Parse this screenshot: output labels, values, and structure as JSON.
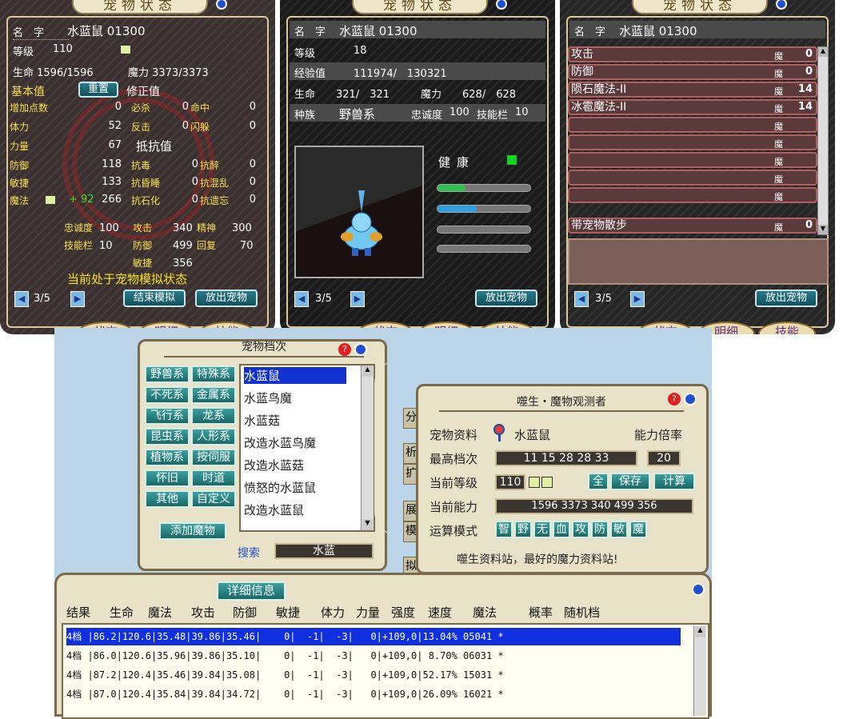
{
  "panel1": {
    "title": "宠物状态",
    "name_label": "名　字",
    "name": "水蓝鼠 01300",
    "level_label": "等级",
    "level": "110",
    "hp_line": "生命 1596/1596",
    "mp_line": "魔力 3373/3373",
    "base_label": "基本值",
    "reset_label": "重置",
    "correct_label": "修正值",
    "left_stats": [
      {
        "label": "增加点数",
        "value": "0"
      },
      {
        "label": "体力",
        "value": "52"
      },
      {
        "label": "力量",
        "value": "67"
      },
      {
        "label": "防御",
        "value": "118"
      },
      {
        "label": "敏捷",
        "value": "133"
      },
      {
        "label": "魔法",
        "value": "266",
        "plus": "+ 92"
      }
    ],
    "correct_stats": [
      {
        "label": "必杀",
        "value": "0"
      },
      {
        "label": "反击",
        "value": "0"
      }
    ],
    "correct_stats_right": [
      {
        "label": "命中",
        "value": "0"
      },
      {
        "label": "闪躲",
        "value": "0"
      }
    ],
    "resist_label": "抵抗值",
    "resist_left": [
      {
        "label": "抗毒",
        "value": "0"
      },
      {
        "label": "抗昏睡",
        "value": "0"
      },
      {
        "label": "抗石化",
        "value": "0"
      }
    ],
    "resist_right": [
      {
        "label": "抗醉",
        "value": "0"
      },
      {
        "label": "抗混乱",
        "value": "0"
      },
      {
        "label": "抗遗忘",
        "value": "0"
      }
    ],
    "loyalty_label": "忠诚度",
    "loyalty": "100",
    "skill_label": "技能栏",
    "skill": "10",
    "atk_label": "攻击",
    "atk": "340",
    "def_label": "防御",
    "def": "499",
    "agi_label": "敏捷",
    "agi": "356",
    "spirit_label": "精神",
    "spirit": "300",
    "recover_label": "回复",
    "recover": "70",
    "sim_notice": "当前处于宠物模拟状态",
    "page": "3/5",
    "end_sim": "结束模拟",
    "release": "放出宠物",
    "tabs": [
      "状态",
      "明细",
      "技能"
    ]
  },
  "panel2": {
    "title": "宠物状态",
    "name_label": "名　字",
    "name": "水蓝鼠 01300",
    "level_label": "等级",
    "level": "18",
    "exp_label": "经验值",
    "exp": "111974/　130321",
    "hp_label": "生命",
    "hp": "321/　321",
    "mp_label": "魔力",
    "mp": "628/　628",
    "race_label": "种族",
    "race": "野兽系",
    "loyalty_label": "忠诚度",
    "loyalty": "100",
    "skill_label": "技能栏",
    "skill": "10",
    "health_label": "健康",
    "page": "3/5",
    "release": "放出宠物",
    "tabs": [
      "状态",
      "明细",
      "技能"
    ],
    "colors": {
      "health": "#10d020",
      "bar1": "#30c050",
      "bar2": "#2aa0e0"
    }
  },
  "panel3": {
    "title": "宠物状态",
    "name_label": "名　字",
    "name": "水蓝鼠 01300",
    "skills": [
      {
        "name": "攻击",
        "mo": "魔",
        "lv": "0"
      },
      {
        "name": "防御",
        "mo": "魔",
        "lv": "0"
      },
      {
        "name": "陨石魔法-II",
        "mo": "魔",
        "lv": "14"
      },
      {
        "name": "冰雹魔法-II",
        "mo": "魔",
        "lv": "14"
      },
      {
        "name": "",
        "mo": "魔",
        "lv": ""
      },
      {
        "name": "",
        "mo": "魔",
        "lv": ""
      },
      {
        "name": "",
        "mo": "魔",
        "lv": ""
      },
      {
        "name": "",
        "mo": "魔",
        "lv": ""
      },
      {
        "name": "",
        "mo": "魔",
        "lv": ""
      },
      {
        "name": "带宠物散步",
        "mo": "魔",
        "lv": "0"
      }
    ],
    "page": "3/5",
    "release": "放出宠物",
    "tabs": [
      "状态",
      "明细",
      "技能"
    ]
  },
  "rank": {
    "title": "宠物档次",
    "categories": [
      "野兽系",
      "特殊系",
      "不死系",
      "金属系",
      "飞行系",
      "龙系",
      "昆虫系",
      "人形系",
      "植物系",
      "按伺服",
      "怀旧",
      "时道",
      "其他",
      "自定义"
    ],
    "list": [
      "水蓝鼠",
      "水蓝鸟魔",
      "水蓝菇",
      "改造水蓝鸟魔",
      "改造水蓝菇",
      "愤怒的水蓝鼠",
      "改造水蓝鼠"
    ],
    "add_label": "添加魔物",
    "search_label": "搜索",
    "search_value": "水蓝",
    "side_tabs": [
      "分",
      "析",
      "扩",
      "展",
      "模",
      "拟"
    ]
  },
  "observer": {
    "title": "噬生・魔物观测者",
    "pet_label": "宠物资料",
    "pet_name": "水蓝鼠",
    "ratio_label": "能力倍率",
    "max_label": "最高档次",
    "max_value": "11 15 28 28 33",
    "ratio_value": "20",
    "lv_label": "当前等级",
    "lv_value": "110",
    "all_label": "全",
    "save_label": "保存",
    "calc_label": "计算",
    "ability_label": "当前能力",
    "ability_value": "1596 3373 340 499 356",
    "mode_label": "运算模式",
    "modes": [
      "智",
      "野",
      "无",
      "血",
      "攻",
      "防",
      "敏",
      "魔"
    ],
    "footer": "噬生资料站，最好的魔力资料站!"
  },
  "details": {
    "button": "详细信息",
    "headers": [
      "结果",
      "生命",
      "魔法",
      "攻击",
      "防御",
      "敏捷",
      "体力",
      "力量",
      "强度",
      "速度",
      "魔法",
      "概率",
      "随机档"
    ],
    "rows": [
      "4档 |86.2|120.6|35.48|39.86|35.46|    0|  -1|  -3|   0|+109,0|13.04% 05041 *",
      "4档 |86.0|120.6|35.96|39.86|35.10|    0|  -1|  -3|   0|+109,0| 8.70% 06031 *",
      "4档 |87.2|120.4|35.46|39.84|35.08|    0|  -1|  -3|   0|+109,0|52.17% 15031 *",
      "4档 |87.0|120.4|35.84|39.84|34.72|    0|  -1|  -3|   0|+109,0|26.09% 16021 *"
    ]
  }
}
